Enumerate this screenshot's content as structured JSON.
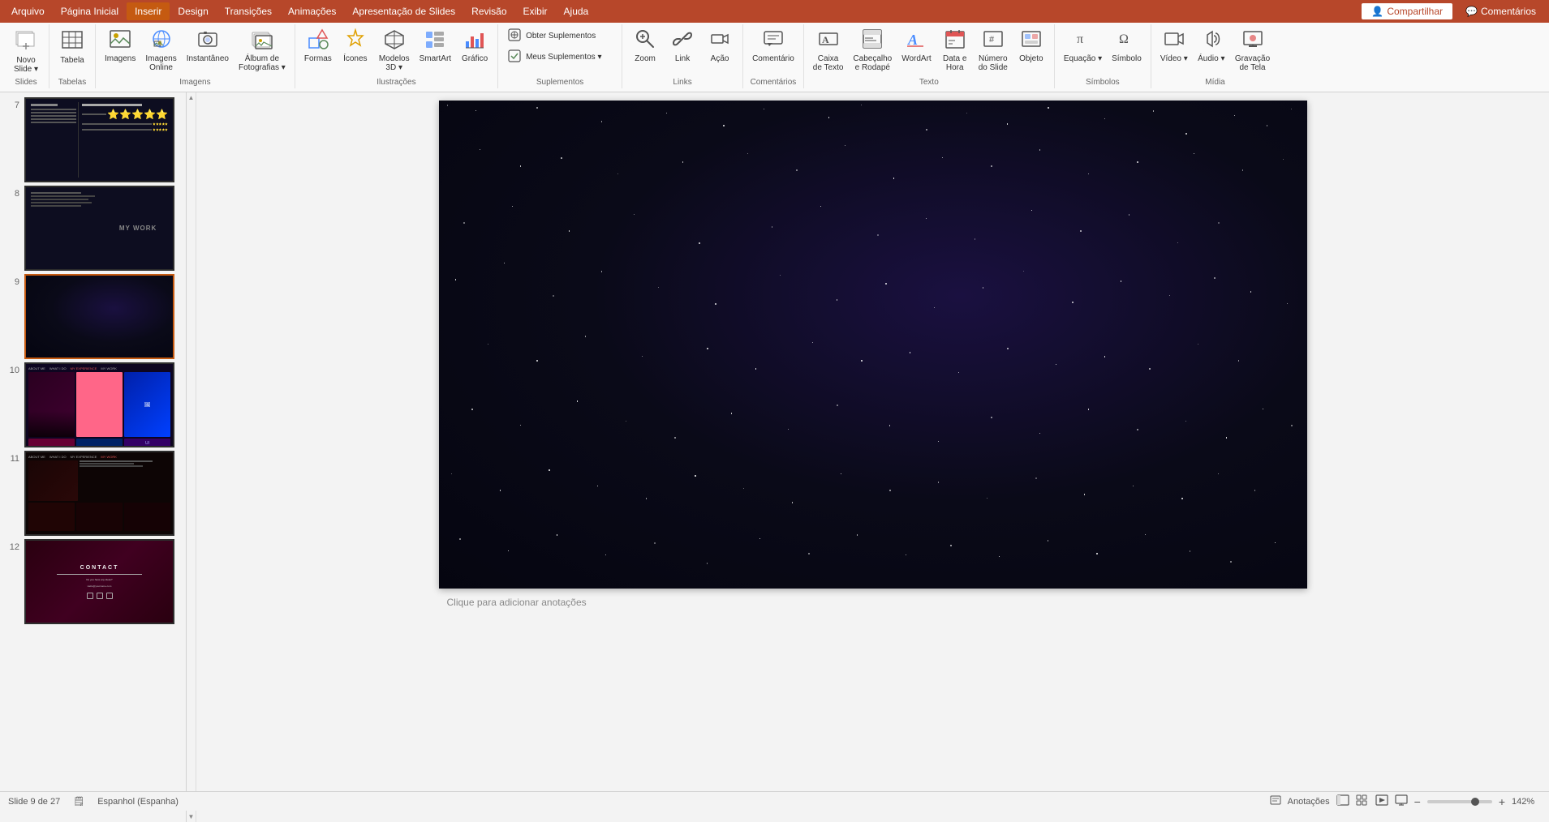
{
  "menubar": {
    "items": [
      "Arquivo",
      "Página Inicial",
      "Inserir",
      "Design",
      "Transições",
      "Animações",
      "Apresentação de Slides",
      "Revisão",
      "Exibir",
      "Ajuda"
    ],
    "active": "Inserir",
    "share_btn": "Compartilhar",
    "comments_btn": "Comentários"
  },
  "ribbon": {
    "groups": [
      {
        "label": "Slides",
        "items": [
          {
            "icon": "🖼",
            "label": "Novo\nSlide",
            "type": "large",
            "has_arrow": true
          }
        ]
      },
      {
        "label": "Tabelas",
        "items": [
          {
            "icon": "⊞",
            "label": "Tabela",
            "type": "large"
          }
        ]
      },
      {
        "label": "Imagens",
        "items": [
          {
            "icon": "🖼",
            "label": "Imagens",
            "type": "large"
          },
          {
            "icon": "🌐",
            "label": "Imagens\nOnline",
            "type": "large"
          },
          {
            "icon": "📷",
            "label": "Instantâneo",
            "type": "large"
          },
          {
            "icon": "📁",
            "label": "Álbum de\nFotografias",
            "type": "large",
            "has_arrow": true
          }
        ]
      },
      {
        "label": "Ilustrações",
        "items": [
          {
            "icon": "⬟",
            "label": "Formas",
            "type": "large"
          },
          {
            "icon": "⭐",
            "label": "Ícones",
            "type": "large"
          },
          {
            "icon": "🧊",
            "label": "Modelos\n3D",
            "type": "large",
            "has_arrow": true
          },
          {
            "icon": "✦",
            "label": "SmartArt",
            "type": "large"
          },
          {
            "icon": "📊",
            "label": "Gráfico",
            "type": "large"
          }
        ]
      },
      {
        "label": "Suplementos",
        "items": [
          {
            "icon": "🔌",
            "label": "Obter Suplementos",
            "type": "small"
          },
          {
            "icon": "🔌",
            "label": "Meus Suplementos",
            "type": "small",
            "has_arrow": true
          }
        ]
      },
      {
        "label": "Links",
        "items": [
          {
            "icon": "🔍",
            "label": "Zoom",
            "type": "large"
          },
          {
            "icon": "🔗",
            "label": "Link",
            "type": "large"
          },
          {
            "icon": "🖱",
            "label": "Ação",
            "type": "large"
          }
        ]
      },
      {
        "label": "Comentários",
        "items": [
          {
            "icon": "💬",
            "label": "Comentário",
            "type": "large"
          }
        ]
      },
      {
        "label": "Texto",
        "items": [
          {
            "icon": "T",
            "label": "Caixa\nde Texto",
            "type": "large"
          },
          {
            "icon": "≡",
            "label": "Cabeçalho\ne Rodapé",
            "type": "large"
          },
          {
            "icon": "A",
            "label": "WordArt",
            "type": "large"
          },
          {
            "icon": "📅",
            "label": "Data e\nHora",
            "type": "large"
          },
          {
            "icon": "#",
            "label": "Número\ndo Slide",
            "type": "large"
          },
          {
            "icon": "⬜",
            "label": "Objeto",
            "type": "large"
          }
        ]
      },
      {
        "label": "Símbolos",
        "items": [
          {
            "icon": "π",
            "label": "Equação",
            "type": "large",
            "has_arrow": true
          },
          {
            "icon": "Ω",
            "label": "Símbolo",
            "type": "large"
          }
        ]
      },
      {
        "label": "Mídia",
        "items": [
          {
            "icon": "🎬",
            "label": "Vídeo",
            "type": "large",
            "has_arrow": true
          },
          {
            "icon": "🔊",
            "label": "Áudio",
            "type": "large",
            "has_arrow": true
          },
          {
            "icon": "⏺",
            "label": "Gravação\nde Tela",
            "type": "large"
          }
        ]
      }
    ]
  },
  "slides": [
    {
      "num": 7,
      "type": "table-dark"
    },
    {
      "num": 8,
      "type": "mywork"
    },
    {
      "num": 9,
      "type": "blank-dark",
      "active": true
    },
    {
      "num": 10,
      "type": "colorful"
    },
    {
      "num": 11,
      "type": "dark-red"
    },
    {
      "num": 12,
      "type": "contact"
    }
  ],
  "main_slide": {
    "type": "blank-dark-space"
  },
  "annotation_placeholder": "Clique para adicionar anotações",
  "status": {
    "slide_info": "Slide 9 de 27",
    "language": "Espanhol (Espanha)",
    "notes_btn": "Anotações",
    "zoom_pct": "142%"
  }
}
